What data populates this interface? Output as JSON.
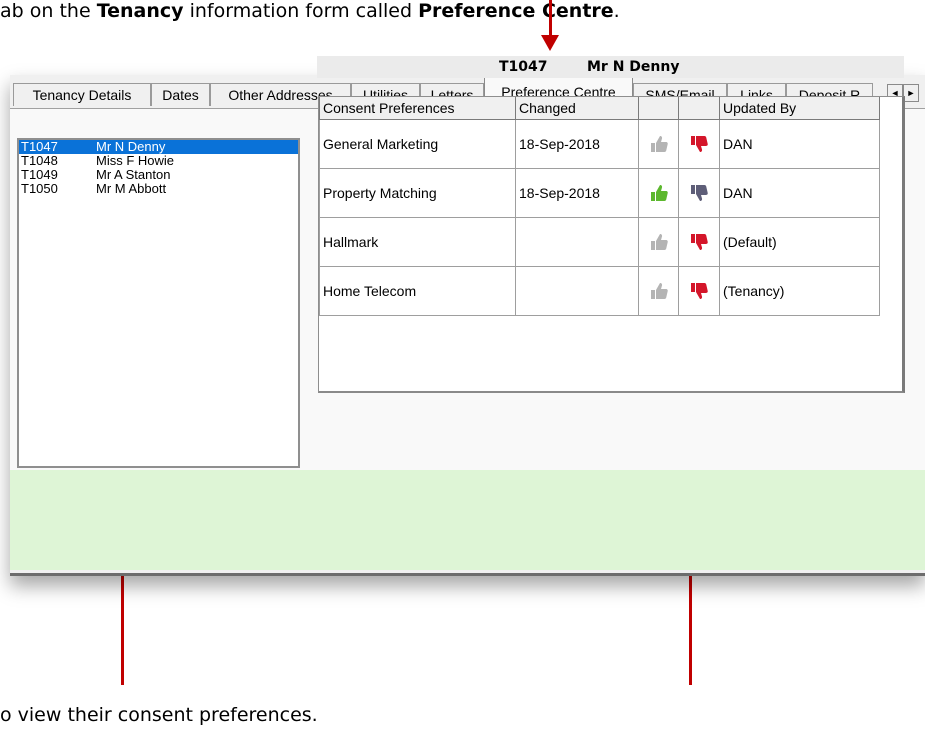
{
  "captions": {
    "top_pre": "ab on the",
    "top_bold1": "Tenancy",
    "top_mid": "information form called",
    "top_bold2": "Preference Centre",
    "top_end": ".",
    "bottom": "o view their consent preferences."
  },
  "tabs": [
    {
      "label": "Tenancy Details"
    },
    {
      "label": "Dates"
    },
    {
      "label": "Other Addresses"
    },
    {
      "label": "Utilities"
    },
    {
      "label": "Letters"
    },
    {
      "label": "Preference Centre",
      "active": true
    },
    {
      "label": "SMS/Email"
    },
    {
      "label": "Links"
    },
    {
      "label": "Deposit R"
    }
  ],
  "tab_scroll": {
    "left": "◄",
    "right": "►"
  },
  "tenants": [
    {
      "code": "T1047",
      "name": "Mr N Denny",
      "selected": true
    },
    {
      "code": "T1048",
      "name": "Miss F Howie"
    },
    {
      "code": "T1049",
      "name": "Mr A Stanton"
    },
    {
      "code": "T1050",
      "name": "Mr M Abbott"
    }
  ],
  "selected_header": {
    "code": "T1047",
    "name": "Mr N Denny"
  },
  "grid": {
    "columns": [
      "Consent Preferences",
      "Changed",
      "",
      "",
      "Updated By"
    ],
    "rows": [
      {
        "preference": "General Marketing",
        "changed": "18-Sep-2018",
        "consent": "no",
        "updated_by": "DAN"
      },
      {
        "preference": "Property Matching",
        "changed": "18-Sep-2018",
        "consent": "yes",
        "updated_by": "DAN"
      },
      {
        "preference": "Hallmark",
        "changed": "",
        "consent": "no",
        "updated_by": "(Default)"
      },
      {
        "preference": "Home Telecom",
        "changed": "",
        "consent": "no",
        "updated_by": "(Tenancy)"
      }
    ]
  },
  "colors": {
    "selection": "#0a72d8",
    "thumb_up_active": "#5cb82e",
    "thumb_up_inactive": "#b4b4b4",
    "thumb_down_active": "#d4162a",
    "thumb_down_inactive": "#5e5e78",
    "footer_green": "#def5d6",
    "arrow": "#c00000"
  },
  "icons": [
    "thumbs-up-icon",
    "thumbs-down-icon",
    "scroll-left-icon",
    "scroll-right-icon"
  ]
}
